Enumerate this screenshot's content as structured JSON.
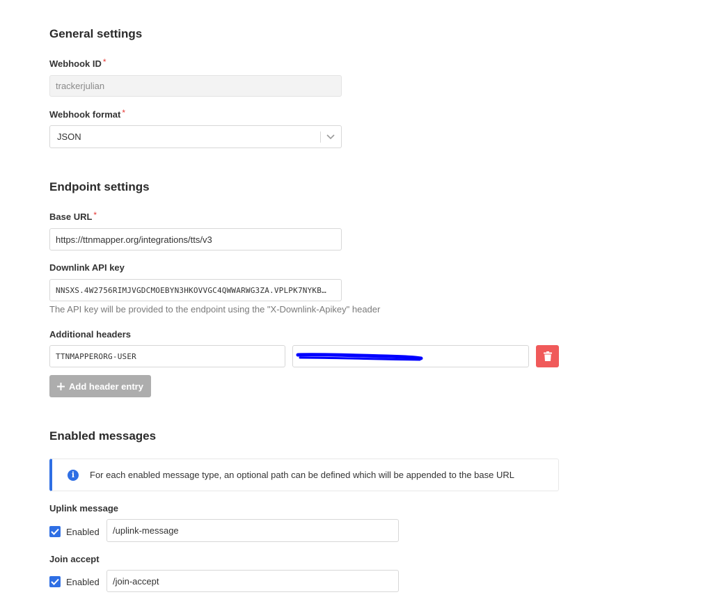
{
  "general": {
    "title": "General settings",
    "webhook_id": {
      "label": "Webhook ID",
      "required": "*",
      "value": "trackerjulian"
    },
    "webhook_format": {
      "label": "Webhook format",
      "required": "*",
      "value": "JSON"
    }
  },
  "endpoint": {
    "title": "Endpoint settings",
    "base_url": {
      "label": "Base URL",
      "required": "*",
      "value": "https://ttnmapper.org/integrations/tts/v3"
    },
    "downlink_api_key": {
      "label": "Downlink API key",
      "value": "NNSXS.4W2756RIMJVGDCMOEBYN3HKOVVGC4QWWARWG3ZA.VPLPK7NYKB…",
      "hint": "The API key will be provided to the endpoint using the \"X-Downlink-Apikey\" header"
    },
    "additional_headers": {
      "label": "Additional headers",
      "rows": [
        {
          "key": "TTNMAPPERORG-USER",
          "value": ""
        }
      ],
      "add_label": "Add header entry"
    }
  },
  "messages": {
    "title": "Enabled messages",
    "notice": "For each enabled message type, an optional path can be defined which will be appended to the base URL",
    "uplink": {
      "label": "Uplink message",
      "enabled_label": "Enabled",
      "path": "/uplink-message"
    },
    "join_accept": {
      "label": "Join accept",
      "enabled_label": "Enabled",
      "path": "/join-accept"
    }
  },
  "colors": {
    "accent": "#2f6fe4",
    "danger": "#f05a5a",
    "redaction": "#0000ff"
  },
  "icons": [
    "chevron-down-icon",
    "trash-icon",
    "plus-icon",
    "info-icon",
    "check-icon"
  ]
}
